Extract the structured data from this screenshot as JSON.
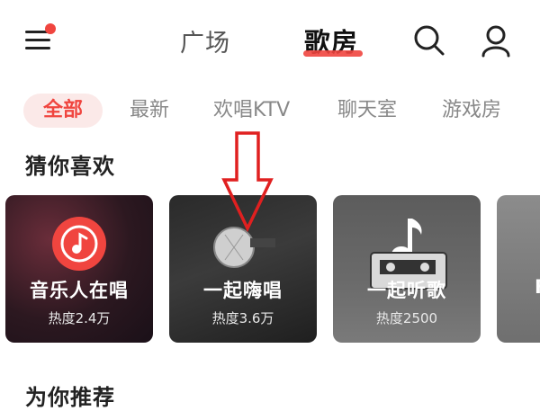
{
  "header": {
    "tabs": [
      {
        "label": "广场",
        "active": false
      },
      {
        "label": "歌房",
        "active": true
      }
    ],
    "menu_has_notification": true
  },
  "categories": [
    {
      "label": "全部",
      "active": true
    },
    {
      "label": "最新",
      "active": false
    },
    {
      "label": "欢唱KTV",
      "active": false
    },
    {
      "label": "聊天室",
      "active": false
    },
    {
      "label": "游戏房",
      "active": false
    }
  ],
  "sections": {
    "guess": "猜你喜欢",
    "recommend": "为你推荐"
  },
  "cards": [
    {
      "label": "音乐人在唱",
      "heat": "热度2.4万",
      "icon": "music-note-circle-icon"
    },
    {
      "label": "一起嗨唱",
      "heat": "热度3.6万",
      "icon": "microphone-icon"
    },
    {
      "label": "一起听歌",
      "heat": "热度2500",
      "icon": "music-note-icon"
    },
    {
      "label": "F",
      "heat": "",
      "icon": "cassette-icon"
    }
  ],
  "colors": {
    "accent": "#f0453f",
    "chip_active_bg": "#fbe9e8",
    "annotation_arrow": "#e02020"
  }
}
